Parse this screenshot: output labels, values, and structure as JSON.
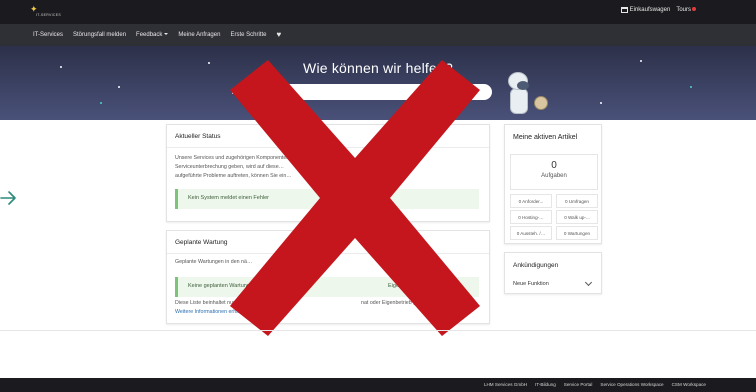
{
  "header": {
    "logo_text": "IT-SERVICES",
    "cart_label": "Einkaufswagen",
    "tours_label": "Tours"
  },
  "nav": {
    "items": [
      "IT-Services",
      "Störungsfall melden",
      "Feedback",
      "Meine Anfragen",
      "Erste Schritte"
    ]
  },
  "hero": {
    "title": "Wie können wir helfen?",
    "search_placeholder": ""
  },
  "status": {
    "title": "Aktueller Status",
    "text_line1": "Unsere Services und zugehörigen Komponenten …",
    "text_line2": "Serviceunterbrechung geben, wird auf diese…",
    "text_line3": "aufgeführte Probleme auftreten, können Sie ein…",
    "ok_message": "Kein System meldet einen Fehler"
  },
  "maintenance": {
    "title": "Geplante Wartung",
    "intro": "Geplante Wartungen in den nä…",
    "ok_message_start": "Keine geplanten Wartungen in R…",
    "ok_message_end": "Eigenbetrieb",
    "note_line1_start": "Diese Liste beinhaltet nur die Serviceange…",
    "note_line1_end": "nat oder Eigenbetrieb genutz…",
    "note_line2_link": "Weitere Informationen erhalten Sie in unserer …"
  },
  "active_items": {
    "title": "Meine aktiven Artikel",
    "tasks_count": "0",
    "tasks_label": "Aufgaben",
    "minis": [
      "0 Anforder...",
      "0 Umfragen",
      "0 Hosting-…",
      "0 Walk up-...",
      "0 Aussteh. /…",
      "0 Wartungen"
    ]
  },
  "announcements": {
    "title": "Ankündigungen",
    "item": "Neue Funktion"
  },
  "footer": {
    "links": [
      "LHM Services GmbH",
      "IT-Bildung",
      "Service Portal",
      "Service Operations Workspace",
      "CSM Workspace"
    ]
  },
  "colors": {
    "hero_bg": "#3e4466",
    "topbar_bg": "#1b1b1f",
    "navbar_bg": "#2f2f36",
    "overlay_x": "#c4161c",
    "ok_bg": "#eef7ec",
    "arrow": "#2e8a7a"
  }
}
